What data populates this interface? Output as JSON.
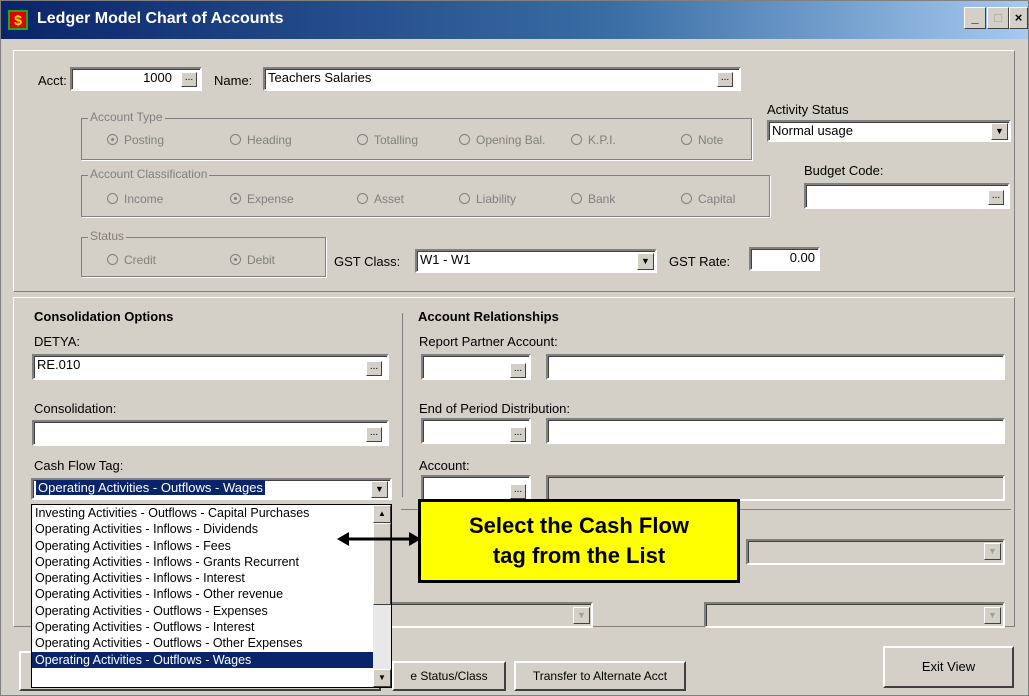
{
  "window": {
    "title": "Ledger Model Chart of Accounts",
    "icon": "dollar-app-icon",
    "minimize": "_",
    "close": "x"
  },
  "acct": {
    "label": "Acct:",
    "value": "1000",
    "dots": "..."
  },
  "name": {
    "label": "Name:",
    "value": "Teachers Salaries"
  },
  "account_type": {
    "title": "Account Type",
    "options": [
      "Posting",
      "Heading",
      "Totalling",
      "Opening Bal.",
      "K.P.I.",
      "Note"
    ],
    "selected": "Posting"
  },
  "account_classification": {
    "title": "Account Classification",
    "options": [
      "Income",
      "Expense",
      "Asset",
      "Liability",
      "Bank",
      "Capital"
    ],
    "selected": "Expense"
  },
  "status": {
    "title": "Status",
    "options": [
      "Credit",
      "Debit"
    ],
    "selected": "Debit"
  },
  "gst_class": {
    "label": "GST Class:",
    "value": "W1 - W1"
  },
  "gst_rate": {
    "label": "GST Rate:",
    "value": "0.00"
  },
  "activity_status": {
    "label": "Activity Status",
    "value": "Normal usage"
  },
  "budget_code": {
    "label": "Budget Code:",
    "value": ""
  },
  "consolidation_options": {
    "heading": "Consolidation Options",
    "detya_label": "DETYA:",
    "detya_value": "RE.010",
    "consolidation_label": "Consolidation:",
    "consolidation_value": "",
    "cashflow_label": "Cash Flow Tag:",
    "cashflow_value": "Operating Activities - Outflows - Wages"
  },
  "account_relationships": {
    "heading": "Account Relationships",
    "report_partner_label": "Report Partner Account:",
    "end_period_label": "End of Period Distribution:",
    "account_label": "Account:"
  },
  "cashflow_list": {
    "items": [
      "Investing Activities - Outflows - Capital Purchases",
      "Operating Activities - Inflows - Dividends",
      "Operating Activities - Inflows - Fees",
      "Operating Activities - Inflows - Grants Recurrent",
      "Operating Activities - Inflows - Interest",
      "Operating Activities - Inflows - Other revenue",
      "Operating Activities - Outflows - Expenses",
      "Operating Activities - Outflows - Interest",
      "Operating Activities - Outflows - Other Expenses",
      "Operating Activities - Outflows - Wages"
    ],
    "selected_index": 9
  },
  "callout": {
    "line1": "Select the Cash Flow",
    "line2": "tag from the List"
  },
  "buttons": {
    "status_class": "e Status/Class",
    "transfer": "Transfer to Alternate Acct",
    "exit": "Exit View"
  }
}
